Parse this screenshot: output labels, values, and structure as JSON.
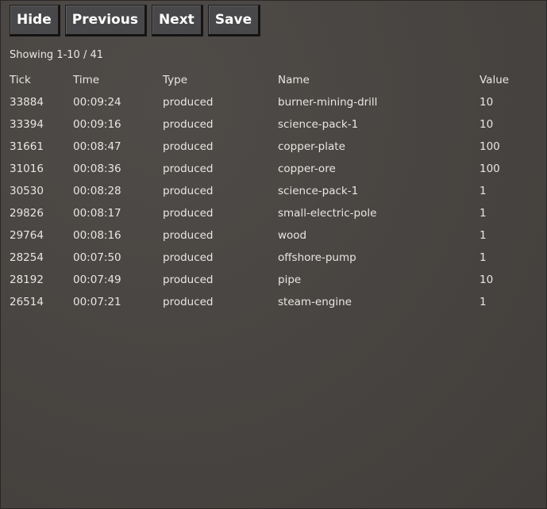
{
  "toolbar": {
    "hide": "Hide",
    "previous": "Previous",
    "next": "Next",
    "save": "Save"
  },
  "status": "Showing 1-10 / 41",
  "table": {
    "headers": [
      "Tick",
      "Time",
      "Type",
      "Name",
      "Value"
    ],
    "rows": [
      [
        "33884",
        "00:09:24",
        "produced",
        "burner-mining-drill",
        "10"
      ],
      [
        "33394",
        "00:09:16",
        "produced",
        "science-pack-1",
        "10"
      ],
      [
        "31661",
        "00:08:47",
        "produced",
        "copper-plate",
        "100"
      ],
      [
        "31016",
        "00:08:36",
        "produced",
        "copper-ore",
        "100"
      ],
      [
        "30530",
        "00:08:28",
        "produced",
        "science-pack-1",
        "1"
      ],
      [
        "29826",
        "00:08:17",
        "produced",
        "small-electric-pole",
        "1"
      ],
      [
        "29764",
        "00:08:16",
        "produced",
        "wood",
        "1"
      ],
      [
        "28254",
        "00:07:50",
        "produced",
        "offshore-pump",
        "1"
      ],
      [
        "28192",
        "00:07:49",
        "produced",
        "pipe",
        "10"
      ],
      [
        "26514",
        "00:07:21",
        "produced",
        "steam-engine",
        "1"
      ]
    ]
  }
}
